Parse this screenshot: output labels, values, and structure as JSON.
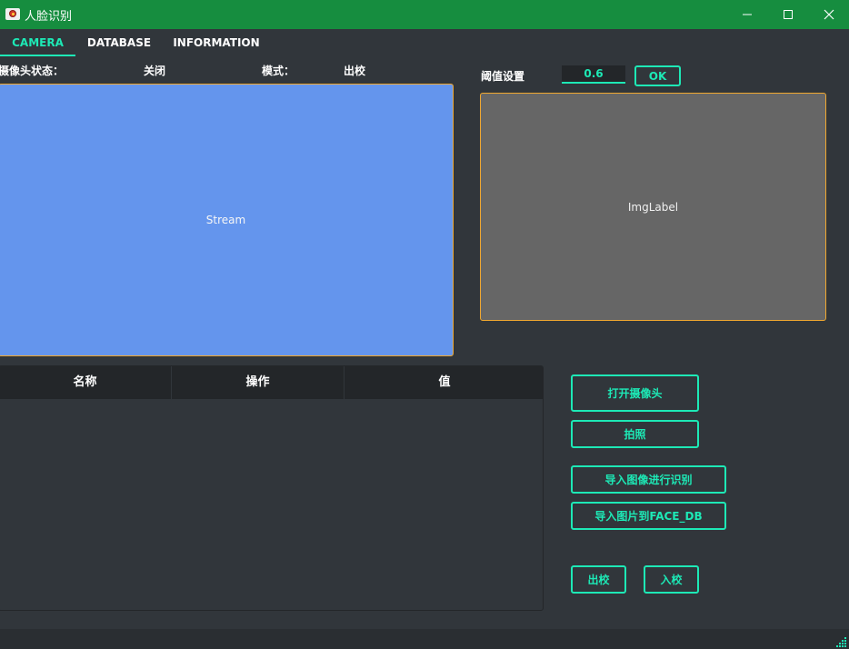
{
  "window": {
    "title": "人脸识别",
    "controls": [
      "minimize-icon",
      "maximize-icon",
      "close-icon"
    ]
  },
  "tabs": [
    {
      "label": "CAMERA",
      "active": true
    },
    {
      "label": "DATABASE",
      "active": false
    },
    {
      "label": "INFORMATION",
      "active": false
    }
  ],
  "camera": {
    "status_label": "摄像头状态：",
    "status_value": "关闭",
    "mode_label": "模式：",
    "mode_value": "出校",
    "stream_text": "Stream"
  },
  "threshold": {
    "label": "阈值设置",
    "value": "0.6",
    "ok_label": "OK"
  },
  "img_label_text": "ImgLabel",
  "table": {
    "columns": [
      "名称",
      "操作",
      "值"
    ],
    "rows": []
  },
  "actions": {
    "open_camera": "打开摄像头",
    "take_photo": "拍照",
    "import_recognize": "导入图像进行识别",
    "import_to_db": "导入图片到FACE_DB",
    "exit_school": "出校",
    "enter_school": "入校"
  },
  "colors": {
    "titlebar": "#168d3f",
    "accent": "#1de9b6",
    "background": "#31363b",
    "stream_bg": "#6495ed",
    "img_bg": "#666666",
    "frame_border": "#f0a830"
  }
}
